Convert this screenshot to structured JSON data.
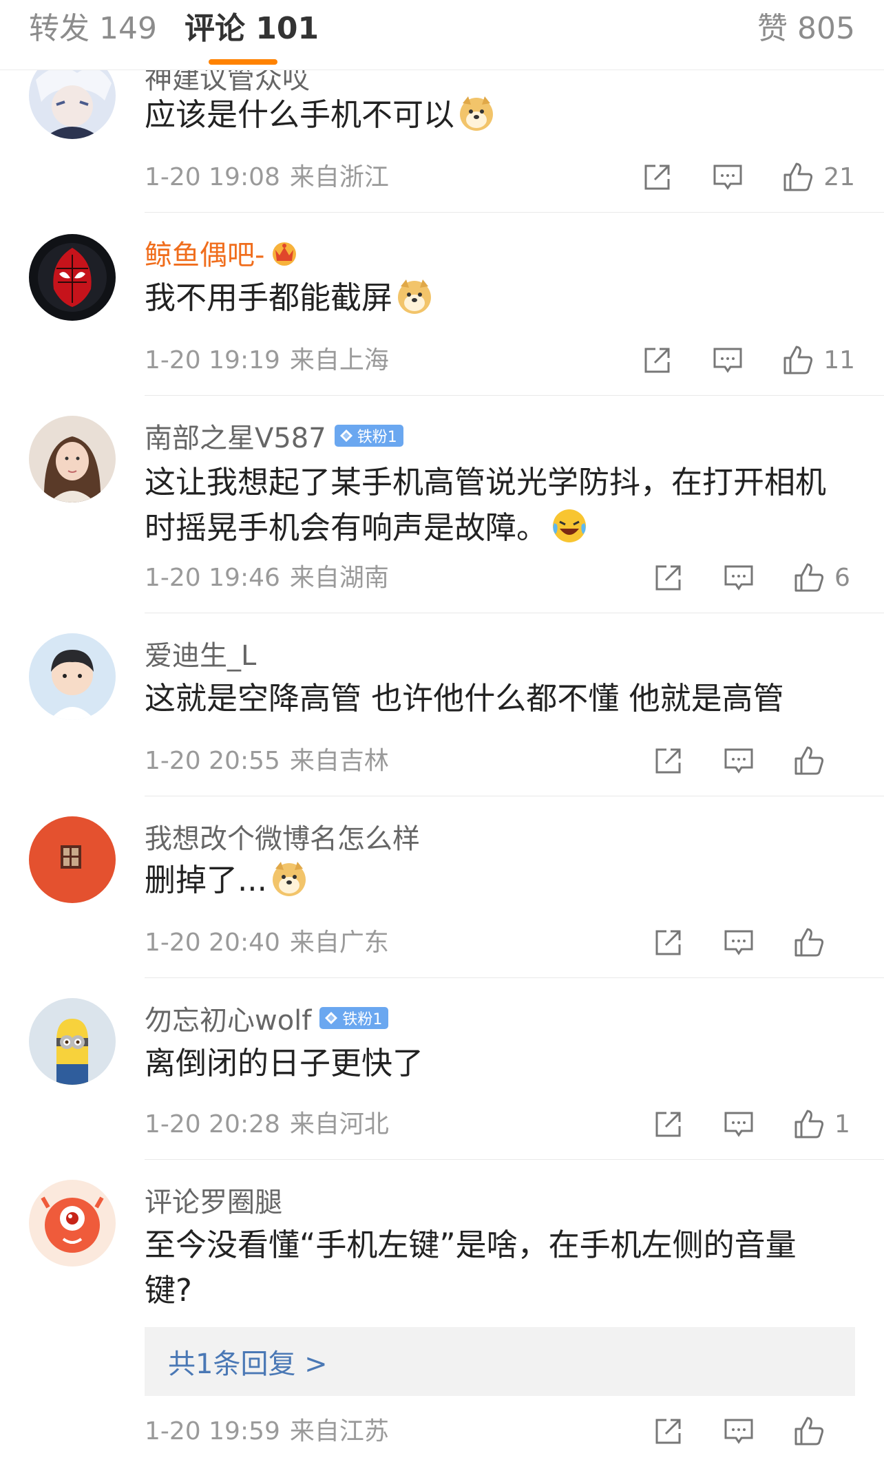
{
  "tabs": {
    "repost": "转发 149",
    "comment": "评论 101",
    "like": "赞 805"
  },
  "colors": {
    "accent": "#ff8200",
    "vip_name": "#f06d1c",
    "link": "#4a78b5",
    "badge": "#6aa7f0"
  },
  "comments": [
    {
      "username": "神建议管众哎",
      "text": "应该是什么手机不可以",
      "emoji": "doge",
      "time": "1-20 19:08",
      "location": "来自浙江",
      "likes": "21"
    },
    {
      "username": "鲸鱼偶吧-",
      "vip": true,
      "text": "我不用手都能截屏",
      "emoji": "doge",
      "time": "1-20 19:19",
      "location": "来自上海",
      "likes": "11"
    },
    {
      "username": "南部之星V587",
      "badge": "铁粉1",
      "text": "这让我想起了某手机高管说光学防抖，在打开相机时摇晃手机会有响声是故障。",
      "emoji": "laugh-cry",
      "time": "1-20 19:46",
      "location": "来自湖南",
      "likes": "6"
    },
    {
      "username": "爱迪生_L",
      "text": "这就是空降高管 也许他什么都不懂  他就是高管",
      "time": "1-20 20:55",
      "location": "来自吉林",
      "likes": ""
    },
    {
      "username": "我想改个微博名怎么样",
      "text": "删掉了...",
      "emoji": "doge",
      "time": "1-20 20:40",
      "location": "来自广东",
      "likes": ""
    },
    {
      "username": "勿忘初心wolf",
      "badge": "铁粉1",
      "text": "离倒闭的日子更快了",
      "time": "1-20 20:28",
      "location": "来自河北",
      "likes": "1"
    },
    {
      "username": "评论罗圈腿",
      "text": "至今没看懂“手机左键”是啥，在手机左侧的音量键?",
      "reply_link": "共1条回复 >",
      "time": "1-20 19:59",
      "location": "来自江苏",
      "likes": ""
    }
  ],
  "icons": {
    "repost": "repost-icon",
    "reply": "comment-icon",
    "like": "thumbs-up-icon",
    "vip": "crown-icon",
    "badge": "diamond-icon"
  }
}
